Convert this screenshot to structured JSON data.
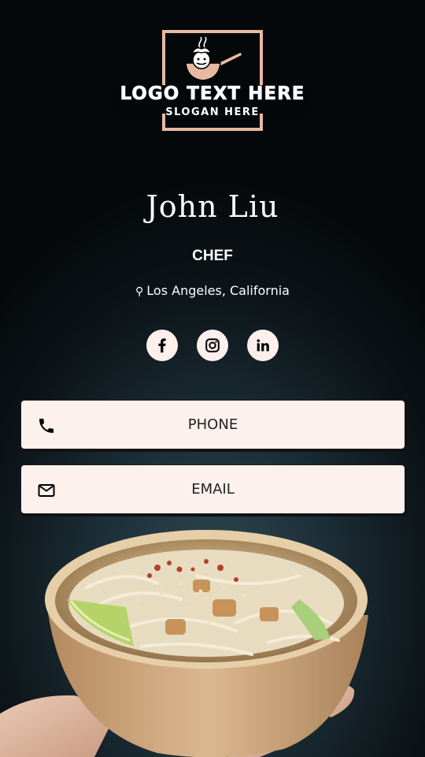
{
  "logo": {
    "text": "LOGO TEXT HERE",
    "slogan": "SLOGAN HERE",
    "icon": "chef-pan-icon",
    "frame_color": "#e7b9a2"
  },
  "profile": {
    "name": "John Liu",
    "role": "CHEF",
    "location": "Los Angeles, California",
    "location_icon": "map-pin-icon"
  },
  "socials": [
    {
      "name": "facebook",
      "icon": "facebook-icon"
    },
    {
      "name": "instagram",
      "icon": "instagram-icon"
    },
    {
      "name": "linkedin",
      "icon": "linkedin-icon"
    }
  ],
  "buttons": {
    "phone_label": "PHONE",
    "phone_icon": "phone-icon",
    "email_label": "EMAIL",
    "email_icon": "mail-icon"
  },
  "colors": {
    "button_bg": "#fdf1ee",
    "social_bg": "#fdf0ec",
    "accent": "#e7b9a2",
    "background": "#05080a"
  },
  "image": {
    "subject": "hand holding bowl of pad thai noodles"
  }
}
